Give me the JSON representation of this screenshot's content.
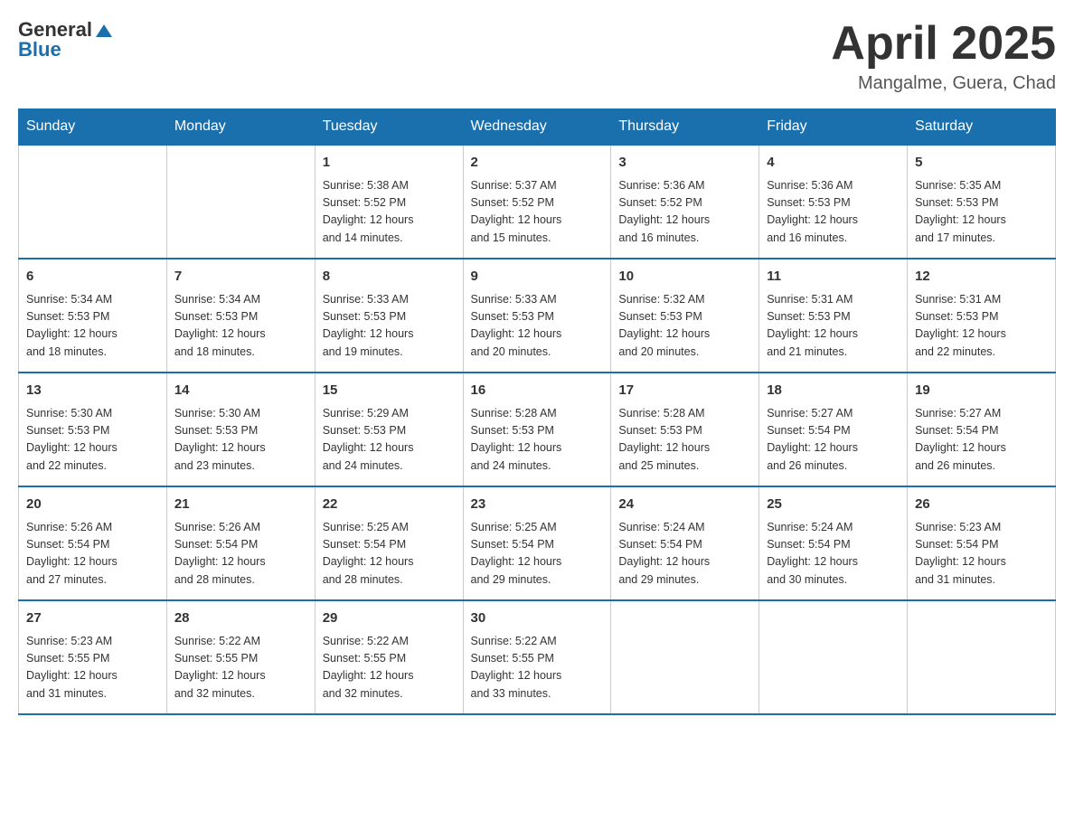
{
  "header": {
    "logo": {
      "general": "General",
      "blue": "Blue"
    },
    "title": "April 2025",
    "location": "Mangalme, Guera, Chad"
  },
  "days_of_week": [
    "Sunday",
    "Monday",
    "Tuesday",
    "Wednesday",
    "Thursday",
    "Friday",
    "Saturday"
  ],
  "weeks": [
    [
      {
        "day": "",
        "info": ""
      },
      {
        "day": "",
        "info": ""
      },
      {
        "day": "1",
        "info": "Sunrise: 5:38 AM\nSunset: 5:52 PM\nDaylight: 12 hours\nand 14 minutes."
      },
      {
        "day": "2",
        "info": "Sunrise: 5:37 AM\nSunset: 5:52 PM\nDaylight: 12 hours\nand 15 minutes."
      },
      {
        "day": "3",
        "info": "Sunrise: 5:36 AM\nSunset: 5:52 PM\nDaylight: 12 hours\nand 16 minutes."
      },
      {
        "day": "4",
        "info": "Sunrise: 5:36 AM\nSunset: 5:53 PM\nDaylight: 12 hours\nand 16 minutes."
      },
      {
        "day": "5",
        "info": "Sunrise: 5:35 AM\nSunset: 5:53 PM\nDaylight: 12 hours\nand 17 minutes."
      }
    ],
    [
      {
        "day": "6",
        "info": "Sunrise: 5:34 AM\nSunset: 5:53 PM\nDaylight: 12 hours\nand 18 minutes."
      },
      {
        "day": "7",
        "info": "Sunrise: 5:34 AM\nSunset: 5:53 PM\nDaylight: 12 hours\nand 18 minutes."
      },
      {
        "day": "8",
        "info": "Sunrise: 5:33 AM\nSunset: 5:53 PM\nDaylight: 12 hours\nand 19 minutes."
      },
      {
        "day": "9",
        "info": "Sunrise: 5:33 AM\nSunset: 5:53 PM\nDaylight: 12 hours\nand 20 minutes."
      },
      {
        "day": "10",
        "info": "Sunrise: 5:32 AM\nSunset: 5:53 PM\nDaylight: 12 hours\nand 20 minutes."
      },
      {
        "day": "11",
        "info": "Sunrise: 5:31 AM\nSunset: 5:53 PM\nDaylight: 12 hours\nand 21 minutes."
      },
      {
        "day": "12",
        "info": "Sunrise: 5:31 AM\nSunset: 5:53 PM\nDaylight: 12 hours\nand 22 minutes."
      }
    ],
    [
      {
        "day": "13",
        "info": "Sunrise: 5:30 AM\nSunset: 5:53 PM\nDaylight: 12 hours\nand 22 minutes."
      },
      {
        "day": "14",
        "info": "Sunrise: 5:30 AM\nSunset: 5:53 PM\nDaylight: 12 hours\nand 23 minutes."
      },
      {
        "day": "15",
        "info": "Sunrise: 5:29 AM\nSunset: 5:53 PM\nDaylight: 12 hours\nand 24 minutes."
      },
      {
        "day": "16",
        "info": "Sunrise: 5:28 AM\nSunset: 5:53 PM\nDaylight: 12 hours\nand 24 minutes."
      },
      {
        "day": "17",
        "info": "Sunrise: 5:28 AM\nSunset: 5:53 PM\nDaylight: 12 hours\nand 25 minutes."
      },
      {
        "day": "18",
        "info": "Sunrise: 5:27 AM\nSunset: 5:54 PM\nDaylight: 12 hours\nand 26 minutes."
      },
      {
        "day": "19",
        "info": "Sunrise: 5:27 AM\nSunset: 5:54 PM\nDaylight: 12 hours\nand 26 minutes."
      }
    ],
    [
      {
        "day": "20",
        "info": "Sunrise: 5:26 AM\nSunset: 5:54 PM\nDaylight: 12 hours\nand 27 minutes."
      },
      {
        "day": "21",
        "info": "Sunrise: 5:26 AM\nSunset: 5:54 PM\nDaylight: 12 hours\nand 28 minutes."
      },
      {
        "day": "22",
        "info": "Sunrise: 5:25 AM\nSunset: 5:54 PM\nDaylight: 12 hours\nand 28 minutes."
      },
      {
        "day": "23",
        "info": "Sunrise: 5:25 AM\nSunset: 5:54 PM\nDaylight: 12 hours\nand 29 minutes."
      },
      {
        "day": "24",
        "info": "Sunrise: 5:24 AM\nSunset: 5:54 PM\nDaylight: 12 hours\nand 29 minutes."
      },
      {
        "day": "25",
        "info": "Sunrise: 5:24 AM\nSunset: 5:54 PM\nDaylight: 12 hours\nand 30 minutes."
      },
      {
        "day": "26",
        "info": "Sunrise: 5:23 AM\nSunset: 5:54 PM\nDaylight: 12 hours\nand 31 minutes."
      }
    ],
    [
      {
        "day": "27",
        "info": "Sunrise: 5:23 AM\nSunset: 5:55 PM\nDaylight: 12 hours\nand 31 minutes."
      },
      {
        "day": "28",
        "info": "Sunrise: 5:22 AM\nSunset: 5:55 PM\nDaylight: 12 hours\nand 32 minutes."
      },
      {
        "day": "29",
        "info": "Sunrise: 5:22 AM\nSunset: 5:55 PM\nDaylight: 12 hours\nand 32 minutes."
      },
      {
        "day": "30",
        "info": "Sunrise: 5:22 AM\nSunset: 5:55 PM\nDaylight: 12 hours\nand 33 minutes."
      },
      {
        "day": "",
        "info": ""
      },
      {
        "day": "",
        "info": ""
      },
      {
        "day": "",
        "info": ""
      }
    ]
  ]
}
